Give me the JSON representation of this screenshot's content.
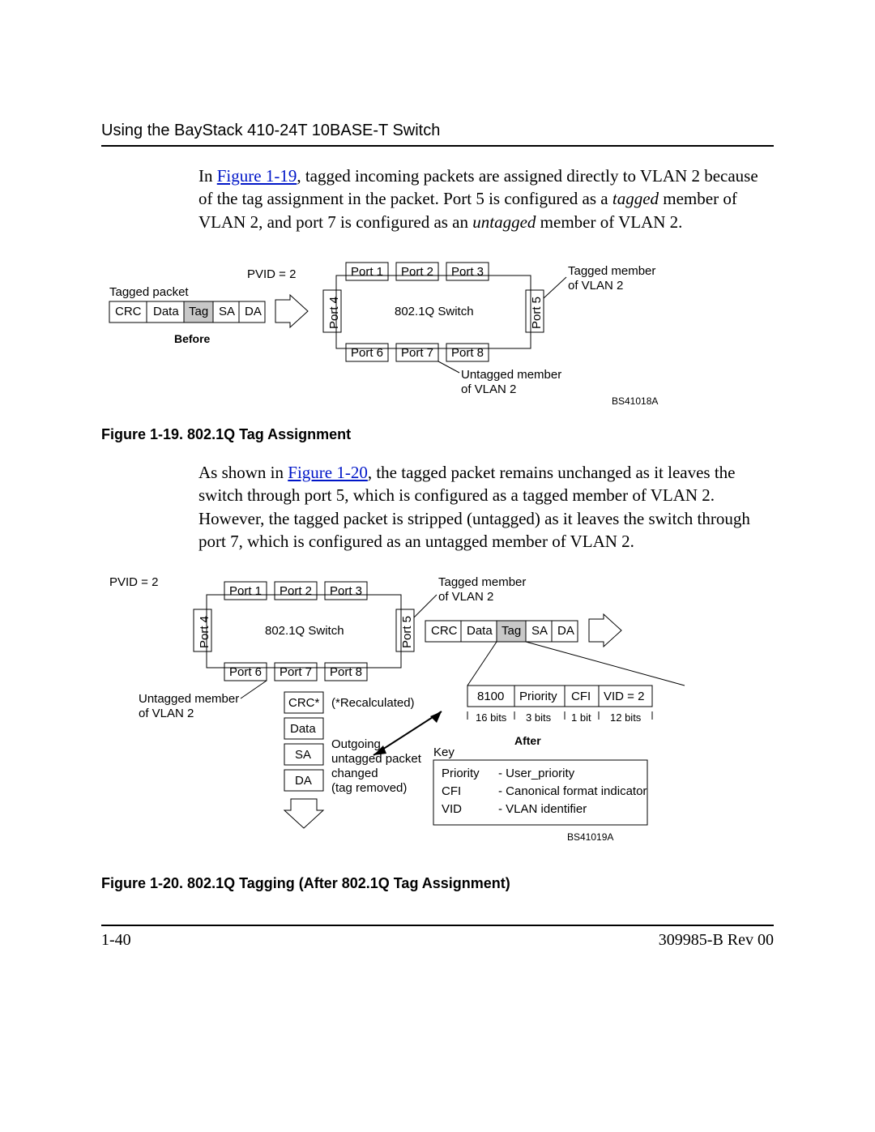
{
  "header": {
    "running_head": "Using the BayStack 410-24T 10BASE-T Switch"
  },
  "para1": {
    "prefix": "In ",
    "link": "Figure 1-19",
    "rest": ", tagged incoming packets are assigned directly to VLAN 2 because of the tag assignment in the packet. Port 5 is configured as a ",
    "italic1": "tagged",
    "mid": " member of VLAN 2, and port 7 is configured as an ",
    "italic2": "untagged",
    "tail": " member of VLAN 2."
  },
  "fig1": {
    "caption": "Figure 1-19.    802.1Q Tag Assignment",
    "labels": {
      "pvid": "PVID = 2",
      "tagged_packet": "Tagged packet",
      "crc": "CRC",
      "data": "Data",
      "tag": "Tag",
      "sa": "SA",
      "da": "DA",
      "before": "Before",
      "port1": "Port 1",
      "port2": "Port 2",
      "port3": "Port 3",
      "port4": "Port 4",
      "port5": "Port 5",
      "port6": "Port 6",
      "port7": "Port 7",
      "port8": "Port 8",
      "switch": "802.1Q Switch",
      "tagged_member": "Tagged member\nof VLAN 2",
      "untagged_member": "Untagged member\nof VLAN 2",
      "code": "BS41018A"
    }
  },
  "para2": {
    "prefix": "As shown in ",
    "link": "Figure 1-20",
    "rest": ", the tagged packet remains unchanged as it leaves the switch through port 5, which is configured as a tagged member of VLAN 2. However, the tagged packet is stripped (untagged) as it leaves the switch through port 7, which is configured as an untagged member of VLAN 2."
  },
  "fig2": {
    "caption": "Figure 1-20.    802.1Q Tagging (After 802.1Q Tag Assignment)",
    "labels": {
      "pvid": "PVID = 2",
      "port1": "Port 1",
      "port2": "Port 2",
      "port3": "Port 3",
      "port4": "Port 4",
      "port5": "Port 5",
      "port6": "Port 6",
      "port7": "Port 7",
      "port8": "Port 8",
      "switch": "802.1Q Switch",
      "tagged_member": "Tagged member\nof VLAN 2",
      "untagged_member": "Untagged member\nof VLAN 2",
      "crc_star": "CRC*",
      "recalc": "(*Recalculated)",
      "data": "Data",
      "sa": "SA",
      "da": "DA",
      "outgoing": "Outgoing\nuntagged packet\nchanged\n(tag removed)",
      "crc": "CRC",
      "tag": "Tag",
      "tag_8100": "8100",
      "priority": "Priority",
      "cfi": "CFI",
      "vid": "VID = 2",
      "bits16": "16 bits",
      "bits3": "3 bits",
      "bits1": "1 bit",
      "bits12": "12 bits",
      "after": "After",
      "key": "Key",
      "key_priority": "Priority",
      "key_priority_v": "- User_priority",
      "key_cfi": "CFI",
      "key_cfi_v": "- Canonical format indicator",
      "key_vid": "VID",
      "key_vid_v": "- VLAN identifier",
      "code": "BS41019A"
    }
  },
  "footer": {
    "page": "1-40",
    "doc": "309985-B Rev 00"
  }
}
